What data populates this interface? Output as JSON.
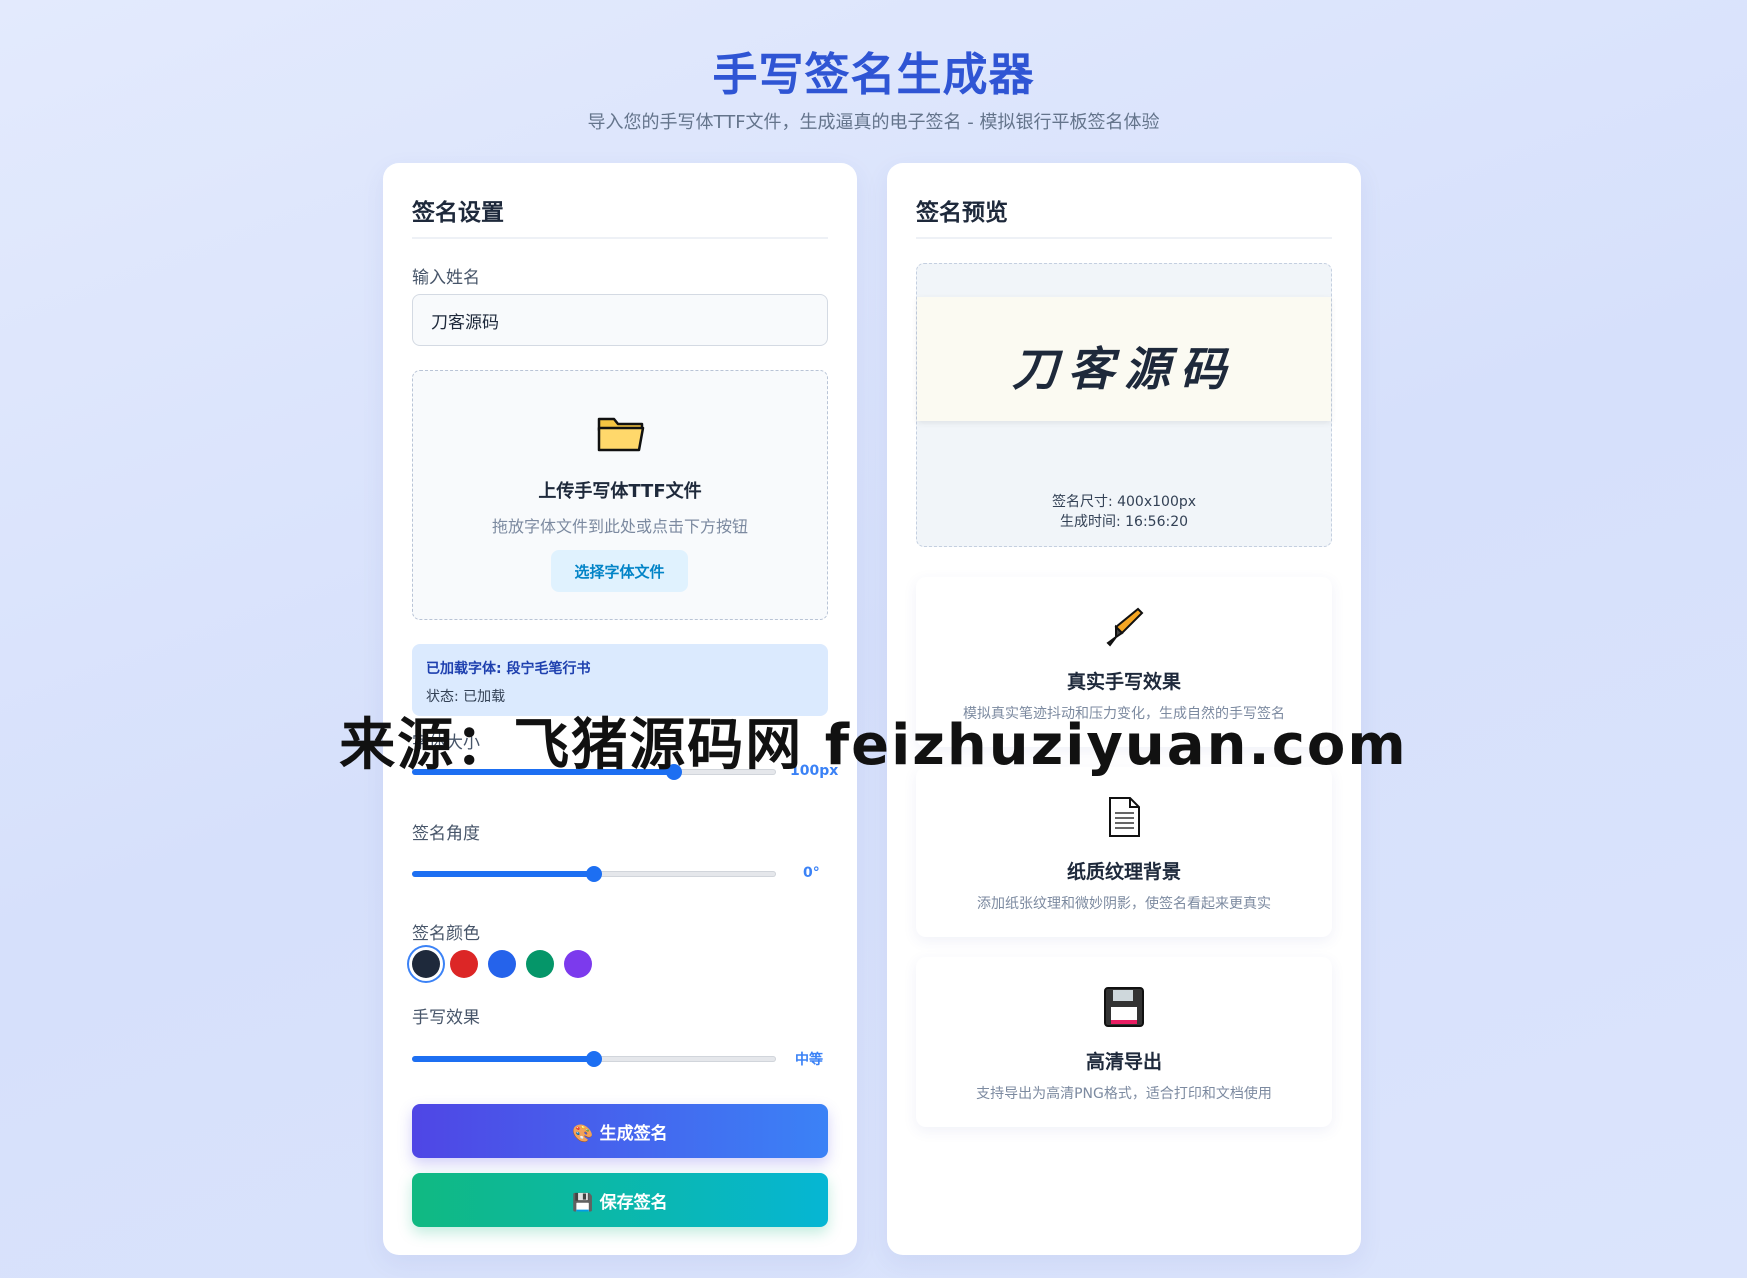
{
  "header": {
    "title": "手写签名生成器",
    "subtitle": "导入您的手写体TTF文件，生成逼真的电子签名 - 模拟银行平板签名体验"
  },
  "settings": {
    "title": "签名设置",
    "name_label": "输入姓名",
    "name_value": "刀客源码",
    "upload": {
      "icon": "folder-icon",
      "title": "上传手写体TTF文件",
      "hint": "拖放字体文件到此处或点击下方按钮",
      "button": "选择字体文件"
    },
    "font_status": {
      "loaded": "已加载字体: 段宁毛笔行书",
      "status": "状态: 已加载"
    },
    "size": {
      "label": "字体大小",
      "value_text": "100px",
      "value": 0.72
    },
    "angle": {
      "label": "签名角度",
      "value_text": "0°",
      "value": 0.5
    },
    "color": {
      "label": "签名颜色",
      "swatches": [
        "#1e293b",
        "#dc2626",
        "#2563eb",
        "#059669",
        "#7c3aed"
      ],
      "selected": 0
    },
    "effect": {
      "label": "手写效果",
      "value_text": "中等",
      "value": 0.5
    },
    "generate_button": {
      "icon": "🎨",
      "label": "生成签名"
    },
    "save_button": {
      "icon": "💾",
      "label": "保存签名"
    }
  },
  "preview": {
    "title": "签名预览",
    "signature": "刀客源码",
    "size_text": "签名尺寸: 400x100px",
    "time_text": "生成时间: 16:56:20"
  },
  "features": [
    {
      "icon": "fountain-pen-icon",
      "title": "真实手写效果",
      "desc": "模拟真实笔迹抖动和压力变化，生成自然的手写签名"
    },
    {
      "icon": "document-icon",
      "title": "纸质纹理背景",
      "desc": "添加纸张纹理和微妙阴影，使签名看起来更真实"
    },
    {
      "icon": "floppy-disk-icon",
      "title": "高清导出",
      "desc": "支持导出为高清PNG格式，适合打印和文档使用"
    }
  ],
  "watermark": "来源：飞猪源码网 feizhuziyuan.com"
}
